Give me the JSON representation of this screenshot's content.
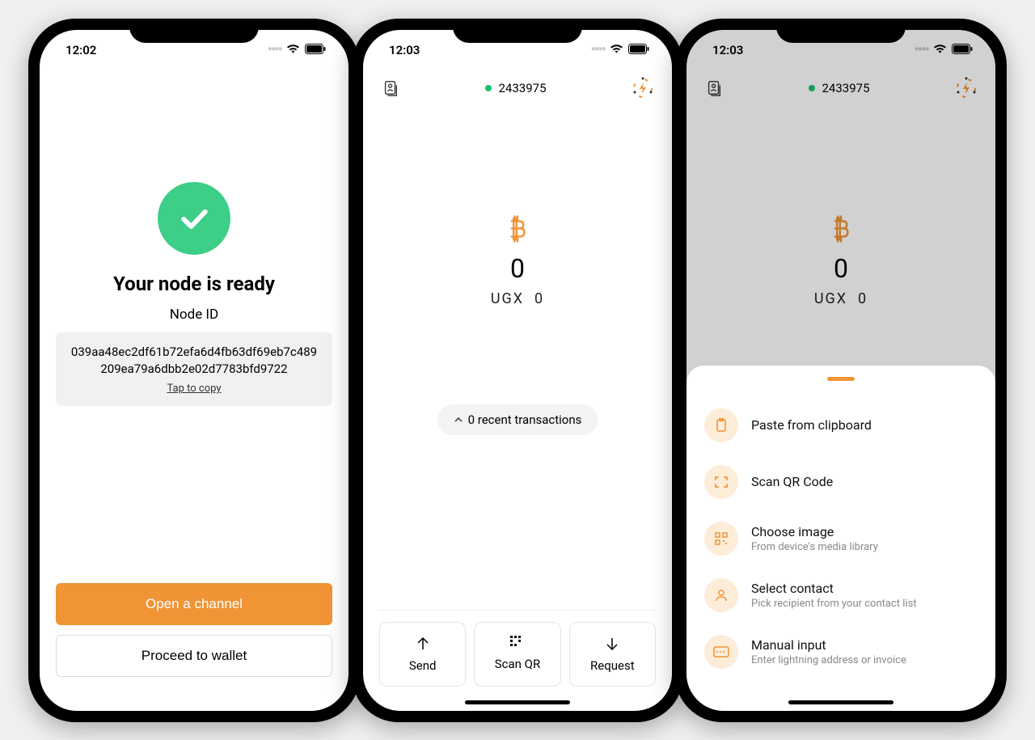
{
  "status": {
    "time1": "12:02",
    "time2": "12:03",
    "time3": "12:03"
  },
  "s1": {
    "title": "Your node is ready",
    "sub": "Node ID",
    "node_id": "039aa48ec2df61b72efa6d4fb63df69eb7c489209ea79a6dbb2e02d7783bfd9722",
    "copy": "Tap to copy",
    "open_channel": "Open a channel",
    "proceed": "Proceed to wallet"
  },
  "header": {
    "block": "2433975"
  },
  "balance": {
    "sats": "0",
    "fiat_label": "UGX",
    "fiat_value": "0"
  },
  "s2": {
    "recent": "0 recent transactions",
    "send": "Send",
    "scan": "Scan QR",
    "request": "Request"
  },
  "sheet": {
    "items": [
      {
        "title": "Paste from clipboard",
        "sub": ""
      },
      {
        "title": "Scan QR Code",
        "sub": ""
      },
      {
        "title": "Choose image",
        "sub": "From device's media library"
      },
      {
        "title": "Select contact",
        "sub": "Pick recipient from your contact list"
      },
      {
        "title": "Manual input",
        "sub": "Enter lightning address or invoice"
      }
    ]
  }
}
